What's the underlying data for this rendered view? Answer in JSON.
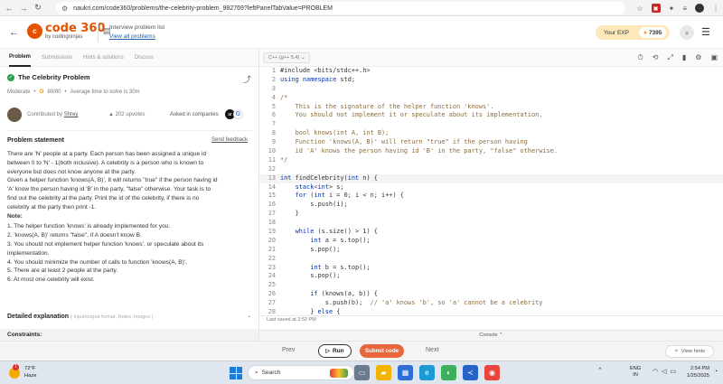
{
  "browser": {
    "url": "naukri.com/code360/problems/the-celebrity-problem_982769?leftPanelTabValue=PROBLEM"
  },
  "header": {
    "logo_main": "code 360",
    "logo_sub": "by codingninjas",
    "interview_list": "Interview problem list",
    "view_all": "View all problems",
    "exp_label": "Your EXP",
    "exp_value": "7395"
  },
  "tabs": [
    "Problem",
    "Submissions",
    "Hints & solutions",
    "Discuss"
  ],
  "problem": {
    "title": "The Celebrity Problem",
    "difficulty": "Moderate",
    "score": "80/80",
    "avg_time": "Average time to solve is 30m",
    "contributed_by": "Contributed by",
    "contributor": "Shrey",
    "upvotes": "202 upvotes",
    "asked_in": "Asked in companies",
    "company_logo_a": "ar",
    "company_logo_g": "G",
    "statement_heading": "Problem statement",
    "send_feedback": "Send feedback",
    "statement_lines": [
      "There are 'N' people at a party. Each person has been assigned a unique id",
      "between 0 to 'N' - 1(both inclusive). A celebrity is a person who is known to",
      "everyone but does not know anyone at the party.",
      "Given a helper function 'knows(A, B)', It will returns \"true\" if the person having id",
      "'A' know the person having id 'B' in the party, \"false\" otherwise. Your task is to",
      "find out the celebrity at the party. Print the id of the celebrity, if there is no",
      "celebrity at the party then print -1."
    ],
    "note_label": "Note:",
    "notes": [
      "1. The helper function 'knows' is already implemented for you.",
      "2. 'knows(A, B)' returns \"false\", if A doesn't know B.",
      "3. You should not implement helper function 'knows', or speculate about its",
      "implementation.",
      "4. You should minimize the number of calls to function 'knows(A, B)'.",
      "5. There are at least 2 people at the party.",
      "6. At most one celebrity will exist."
    ],
    "detailed_label": "Detailed explanation",
    "detailed_sub": "( Input/output format, Notes, Images )",
    "constraints_label": "Constraints:"
  },
  "editor": {
    "language": "C++ (g++ 5.4)",
    "lines": [
      "#include <bits/stdc++.h>",
      "using namespace std;",
      "",
      "/*",
      "    This is the signature of the helper function 'knows'.",
      "    You should not implement it or speculate about its implementation.",
      "",
      "    bool knows(int A, int B);",
      "    Function 'knows(A, B)' will return \"true\" if the person having",
      "    id 'A' knows the person having id 'B' in the party, \"false\" otherwise.",
      "*/",
      "",
      "int findCelebrity(int n) {",
      "    stack<int> s;",
      "    for (int i = 0; i < n; i++) {",
      "        s.push(i);",
      "    }",
      "",
      "    while (s.size() > 1) {",
      "        int a = s.top();",
      "        s.pop();",
      "",
      "        int b = s.top();",
      "        s.pop();",
      "",
      "        if (knows(a, b)) {",
      "            s.push(b);  // 'a' knows 'b', so 'a' cannot be a celebrity",
      "        } else {"
    ],
    "last_saved": "Last saved at 2:52 PM",
    "console": "Console"
  },
  "bottom": {
    "prev": "Prev",
    "run": "Run",
    "submit": "Submit code",
    "next": "Next",
    "hints": "View hints"
  },
  "taskbar": {
    "temp": "72°F",
    "weather": "Haze",
    "search": "Search",
    "lang1": "ENG",
    "lang2": "IN",
    "time": "2:54 PM",
    "date": "1/25/2025"
  }
}
